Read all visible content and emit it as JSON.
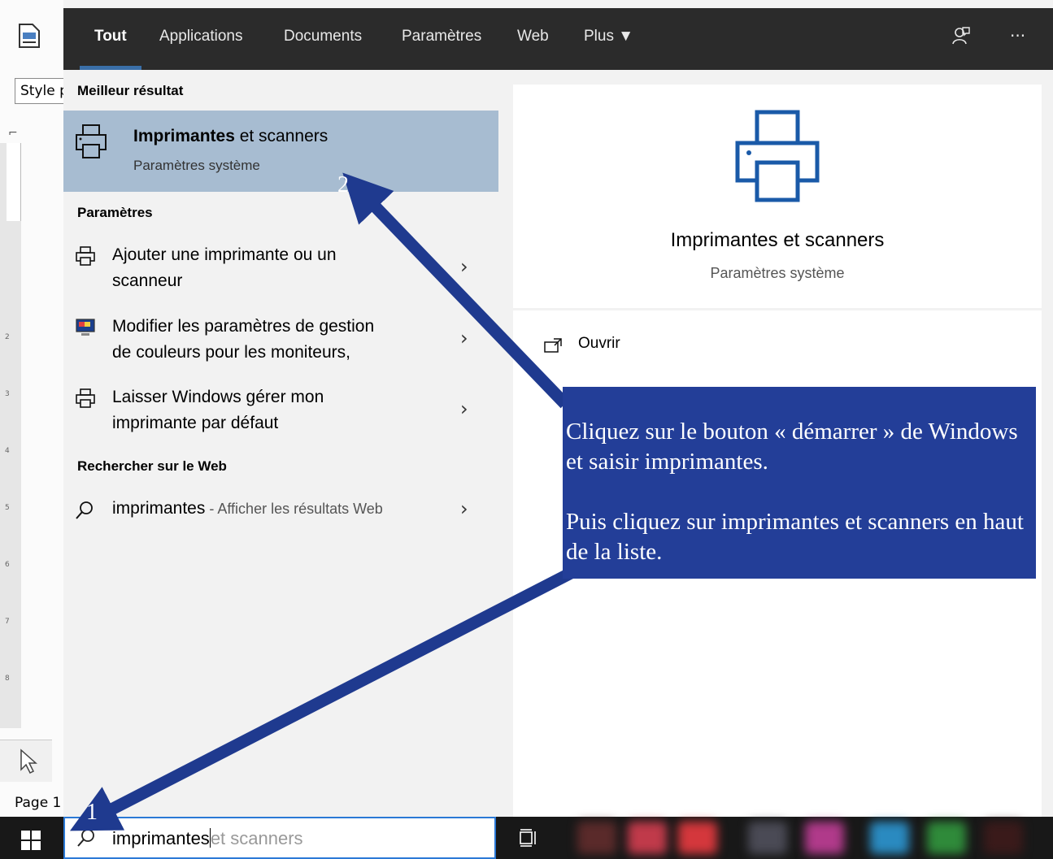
{
  "background_app": {
    "style_box_text": "Style p",
    "page_label": "Page 1"
  },
  "tabs": [
    {
      "label": "Tout",
      "active": true
    },
    {
      "label": "Applications"
    },
    {
      "label": "Documents"
    },
    {
      "label": "Paramètres"
    },
    {
      "label": "Web"
    },
    {
      "label": "Plus ▼"
    }
  ],
  "top_icons": {
    "feedback": "feedback-icon",
    "more": "···"
  },
  "left_pane": {
    "best_match_heading": "Meilleur résultat",
    "best_match": {
      "title_bold": "Imprimantes",
      "title_rest": " et scanners",
      "subtitle": "Paramètres système"
    },
    "settings_heading": "Paramètres",
    "settings": [
      {
        "lines": [
          "Ajouter une imprimante ou un",
          "scanneur"
        ],
        "icon": "printer-icon"
      },
      {
        "lines": [
          "Modifier les paramètres de gestion",
          "de couleurs pour les moniteurs,"
        ],
        "icon": "monitor-icon"
      },
      {
        "lines": [
          "Laisser Windows gérer mon",
          "imprimante par défaut"
        ],
        "icon": "printer-icon"
      }
    ],
    "web_heading": "Rechercher sur le Web",
    "web_result": {
      "query": "imprimantes",
      "suffix": " - Afficher les résultats Web"
    },
    "chevron": "›"
  },
  "right_pane": {
    "title": "Imprimantes et scanners",
    "subtitle": "Paramètres système",
    "action_label": "Ouvrir"
  },
  "taskbar": {
    "search_typed": "imprimantes",
    "search_suggestion": "et scanners"
  },
  "annotation": {
    "paragraphs": [
      "Cliquez sur le bouton « démarrer » de Windows et saisir imprimantes.",
      "Puis cliquez sur imprimantes et scanners en haut de la liste."
    ],
    "step_1": "1",
    "step_2": "2",
    "callout_color": "#233e98",
    "arrow_color": "#1f3a8f"
  }
}
